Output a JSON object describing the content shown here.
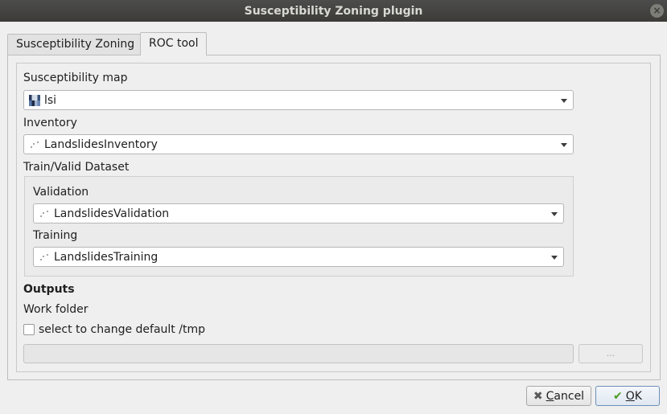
{
  "window": {
    "title": "Susceptibility Zoning plugin",
    "close_glyph": "×"
  },
  "tabs": [
    {
      "label": "Susceptibility Zoning",
      "active": false
    },
    {
      "label": "ROC tool",
      "active": true
    }
  ],
  "form": {
    "susceptibility_map": {
      "label": "Susceptibility map",
      "value": "lsi",
      "icon": "raster-layer-icon"
    },
    "inventory": {
      "label": "Inventory",
      "value": "LandslidesInventory",
      "icon": "point-layer-icon"
    },
    "train_valid": {
      "label": "Train/Valid Dataset",
      "validation": {
        "label": "Validation",
        "value": "LandslidesValidation",
        "icon": "point-layer-icon"
      },
      "training": {
        "label": "Training",
        "value": "LandslidesTraining",
        "icon": "point-layer-icon"
      }
    },
    "outputs": {
      "heading": "Outputs",
      "work_folder_label": "Work folder",
      "checkbox_label": "select to change default /tmp",
      "checkbox_checked": false,
      "path_value": "",
      "browse_label": "..."
    }
  },
  "buttons": {
    "cancel": {
      "mnemonic": "C",
      "rest": "ancel",
      "icon": "cancel-icon"
    },
    "ok": {
      "mnemonic": "O",
      "rest": "K",
      "icon": "checkmark-icon"
    }
  },
  "colors": {
    "titlebar": "#3c3b37",
    "window_bg": "#efefef",
    "ok_check": "#4a9a1e",
    "cancel_x": "#5a5a5a"
  }
}
